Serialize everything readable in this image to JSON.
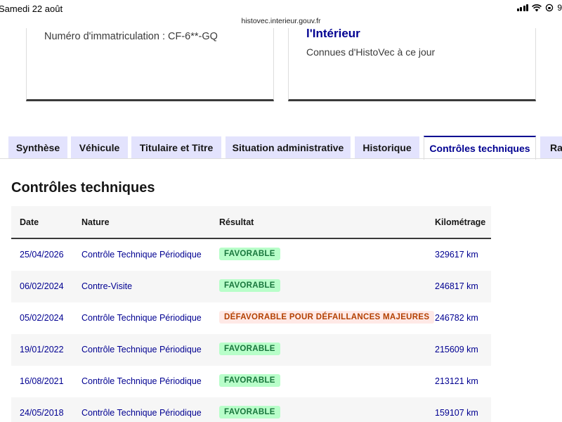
{
  "status_bar": {
    "time": "Samedi 22 août",
    "battery": "9"
  },
  "browser": {
    "url": "histovec.interieur.gouv.fr"
  },
  "cards": {
    "left_text": "Numéro d'immatriculation : CF-6**-GQ",
    "right_title": "l'Intérieur",
    "right_subtitle": "Connues d'HistoVec à ce jour"
  },
  "tabs": [
    {
      "label": "Synthèse"
    },
    {
      "label": "Véhicule"
    },
    {
      "label": "Titulaire et Titre"
    },
    {
      "label": "Situation administrative"
    },
    {
      "label": "Historique"
    },
    {
      "label": "Contrôles techniques"
    },
    {
      "label": "Rap"
    }
  ],
  "colors": {
    "accent": "#000091",
    "tab_bg": "#e3e3fd",
    "success_bg": "#b8fec9",
    "success_text": "#18753c",
    "error_bg": "#ffe9e6",
    "error_text": "#b34000"
  },
  "section": {
    "title": "Contrôles techniques"
  },
  "table": {
    "headers": {
      "date": "Date",
      "nature": "Nature",
      "result": "Résultat",
      "km": "Kilométrage"
    },
    "rows": [
      {
        "date": "25/04/2026",
        "nature": "Contrôle Technique Périodique",
        "result": "FAVORABLE",
        "status": "ok",
        "km": "329617 km"
      },
      {
        "date": "06/02/2024",
        "nature": "Contre-Visite",
        "result": "FAVORABLE",
        "status": "ok",
        "km": "246817 km"
      },
      {
        "date": "05/02/2024",
        "nature": "Contrôle Technique Périodique",
        "result": "DÉFAVORABLE POUR DÉFAILLANCES MAJEURES",
        "status": "ko",
        "km": "246782 km"
      },
      {
        "date": "19/01/2022",
        "nature": "Contrôle Technique Périodique",
        "result": "FAVORABLE",
        "status": "ok",
        "km": "215609 km"
      },
      {
        "date": "16/08/2021",
        "nature": "Contrôle Technique Périodique",
        "result": "FAVORABLE",
        "status": "ok",
        "km": "213121 km"
      },
      {
        "date": "24/05/2018",
        "nature": "Contrôle Technique Périodique",
        "result": "FAVORABLE",
        "status": "ok",
        "km": "159107 km"
      }
    ]
  }
}
